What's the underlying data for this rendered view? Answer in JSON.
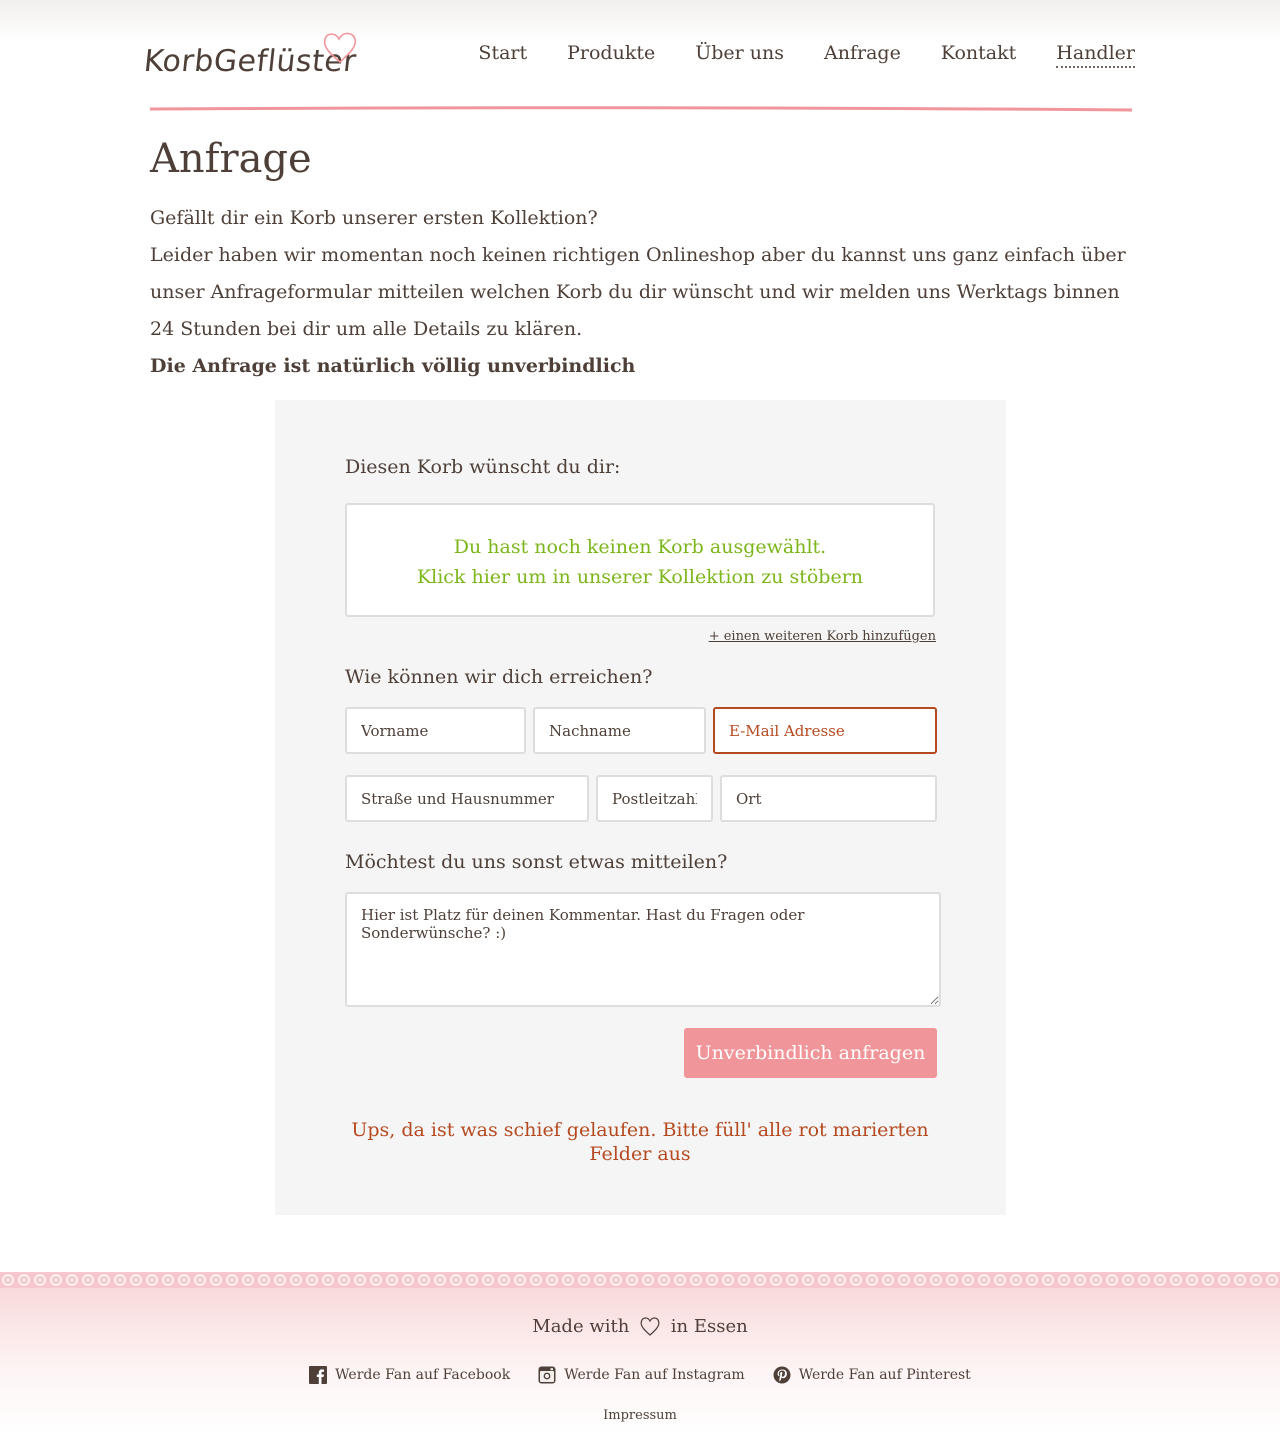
{
  "header": {
    "logo_text": "KorbGeflüster",
    "nav": [
      {
        "label": "Start"
      },
      {
        "label": "Produkte"
      },
      {
        "label": "Über uns"
      },
      {
        "label": "Anfrage"
      },
      {
        "label": "Kontakt"
      },
      {
        "label": "Handler"
      }
    ]
  },
  "main": {
    "title": "Anfrage",
    "intro_line1": "Gefällt dir ein Korb unserer ersten Kollektion?",
    "intro_line2": "Leider haben wir momentan noch keinen richtigen Onlineshop aber du kannst uns ganz einfach über unser Anfrageformular mitteilen welchen Korb du dir wünscht und wir melden uns Werktags binnen 24 Stunden bei dir um alle Details zu klären.",
    "intro_strong": "Die Anfrage ist natürlich völlig unverbindlich"
  },
  "form": {
    "basket_label": "Diesen Korb wünscht du dir:",
    "basket_empty_line1": "Du hast noch keinen Korb ausgewählt.",
    "basket_empty_line2": "Klick hier um in unserer Kollektion zu stöbern",
    "add_basket_link": "+ einen weiteren Korb hinzufügen",
    "contact_label": "Wie können wir dich erreichen?",
    "firstname_placeholder": "Vorname",
    "lastname_placeholder": "Nachname",
    "email_placeholder": "E-Mail Adresse",
    "street_placeholder": "Straße und Hausnummer",
    "zip_placeholder": "Postleitzahl",
    "city_placeholder": "Ort",
    "message_label": "Möchtest du uns sonst etwas mitteilen?",
    "comment_placeholder": "Hier ist Platz für deinen Kommentar. Hast du Fragen oder Sonderwünsche? :)",
    "submit_label": "Unverbindlich anfragen",
    "error_message": "Ups, da ist was schief gelaufen. Bitte füll' alle rot marierten Felder aus"
  },
  "footer": {
    "made_with_prefix": "Made with",
    "made_with_suffix": "in Essen",
    "facebook": "Werde Fan auf Facebook",
    "instagram": "Werde Fan auf Instagram",
    "pinterest": "Werde Fan auf Pinterest",
    "impressum": "Impressum"
  },
  "colors": {
    "text": "#4e4038",
    "accent_pink": "#f0969a",
    "basket_green": "#7cb61b",
    "error": "#b5491f",
    "panel_bg": "#f5f5f5"
  }
}
